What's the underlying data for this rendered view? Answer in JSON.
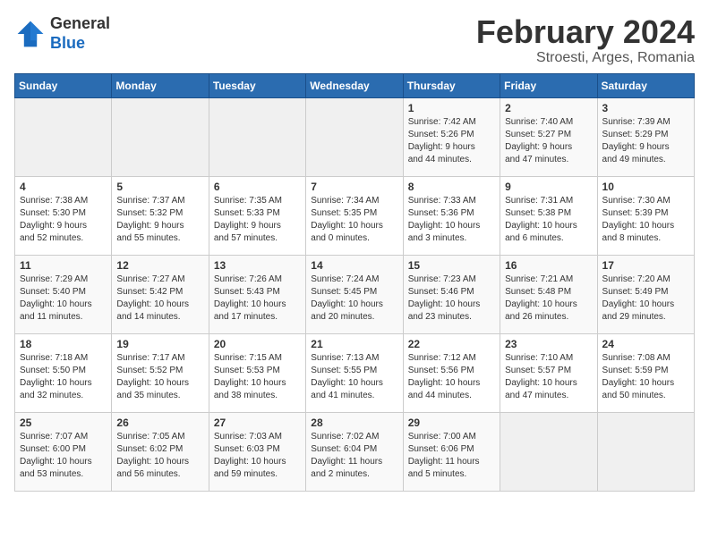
{
  "header": {
    "logo_line1": "General",
    "logo_line2": "Blue",
    "main_title": "February 2024",
    "sub_title": "Stroesti, Arges, Romania"
  },
  "days_of_week": [
    "Sunday",
    "Monday",
    "Tuesday",
    "Wednesday",
    "Thursday",
    "Friday",
    "Saturday"
  ],
  "weeks": [
    [
      {
        "day": "",
        "content": ""
      },
      {
        "day": "",
        "content": ""
      },
      {
        "day": "",
        "content": ""
      },
      {
        "day": "",
        "content": ""
      },
      {
        "day": "1",
        "content": "Sunrise: 7:42 AM\nSunset: 5:26 PM\nDaylight: 9 hours\nand 44 minutes."
      },
      {
        "day": "2",
        "content": "Sunrise: 7:40 AM\nSunset: 5:27 PM\nDaylight: 9 hours\nand 47 minutes."
      },
      {
        "day": "3",
        "content": "Sunrise: 7:39 AM\nSunset: 5:29 PM\nDaylight: 9 hours\nand 49 minutes."
      }
    ],
    [
      {
        "day": "4",
        "content": "Sunrise: 7:38 AM\nSunset: 5:30 PM\nDaylight: 9 hours\nand 52 minutes."
      },
      {
        "day": "5",
        "content": "Sunrise: 7:37 AM\nSunset: 5:32 PM\nDaylight: 9 hours\nand 55 minutes."
      },
      {
        "day": "6",
        "content": "Sunrise: 7:35 AM\nSunset: 5:33 PM\nDaylight: 9 hours\nand 57 minutes."
      },
      {
        "day": "7",
        "content": "Sunrise: 7:34 AM\nSunset: 5:35 PM\nDaylight: 10 hours\nand 0 minutes."
      },
      {
        "day": "8",
        "content": "Sunrise: 7:33 AM\nSunset: 5:36 PM\nDaylight: 10 hours\nand 3 minutes."
      },
      {
        "day": "9",
        "content": "Sunrise: 7:31 AM\nSunset: 5:38 PM\nDaylight: 10 hours\nand 6 minutes."
      },
      {
        "day": "10",
        "content": "Sunrise: 7:30 AM\nSunset: 5:39 PM\nDaylight: 10 hours\nand 8 minutes."
      }
    ],
    [
      {
        "day": "11",
        "content": "Sunrise: 7:29 AM\nSunset: 5:40 PM\nDaylight: 10 hours\nand 11 minutes."
      },
      {
        "day": "12",
        "content": "Sunrise: 7:27 AM\nSunset: 5:42 PM\nDaylight: 10 hours\nand 14 minutes."
      },
      {
        "day": "13",
        "content": "Sunrise: 7:26 AM\nSunset: 5:43 PM\nDaylight: 10 hours\nand 17 minutes."
      },
      {
        "day": "14",
        "content": "Sunrise: 7:24 AM\nSunset: 5:45 PM\nDaylight: 10 hours\nand 20 minutes."
      },
      {
        "day": "15",
        "content": "Sunrise: 7:23 AM\nSunset: 5:46 PM\nDaylight: 10 hours\nand 23 minutes."
      },
      {
        "day": "16",
        "content": "Sunrise: 7:21 AM\nSunset: 5:48 PM\nDaylight: 10 hours\nand 26 minutes."
      },
      {
        "day": "17",
        "content": "Sunrise: 7:20 AM\nSunset: 5:49 PM\nDaylight: 10 hours\nand 29 minutes."
      }
    ],
    [
      {
        "day": "18",
        "content": "Sunrise: 7:18 AM\nSunset: 5:50 PM\nDaylight: 10 hours\nand 32 minutes."
      },
      {
        "day": "19",
        "content": "Sunrise: 7:17 AM\nSunset: 5:52 PM\nDaylight: 10 hours\nand 35 minutes."
      },
      {
        "day": "20",
        "content": "Sunrise: 7:15 AM\nSunset: 5:53 PM\nDaylight: 10 hours\nand 38 minutes."
      },
      {
        "day": "21",
        "content": "Sunrise: 7:13 AM\nSunset: 5:55 PM\nDaylight: 10 hours\nand 41 minutes."
      },
      {
        "day": "22",
        "content": "Sunrise: 7:12 AM\nSunset: 5:56 PM\nDaylight: 10 hours\nand 44 minutes."
      },
      {
        "day": "23",
        "content": "Sunrise: 7:10 AM\nSunset: 5:57 PM\nDaylight: 10 hours\nand 47 minutes."
      },
      {
        "day": "24",
        "content": "Sunrise: 7:08 AM\nSunset: 5:59 PM\nDaylight: 10 hours\nand 50 minutes."
      }
    ],
    [
      {
        "day": "25",
        "content": "Sunrise: 7:07 AM\nSunset: 6:00 PM\nDaylight: 10 hours\nand 53 minutes."
      },
      {
        "day": "26",
        "content": "Sunrise: 7:05 AM\nSunset: 6:02 PM\nDaylight: 10 hours\nand 56 minutes."
      },
      {
        "day": "27",
        "content": "Sunrise: 7:03 AM\nSunset: 6:03 PM\nDaylight: 10 hours\nand 59 minutes."
      },
      {
        "day": "28",
        "content": "Sunrise: 7:02 AM\nSunset: 6:04 PM\nDaylight: 11 hours\nand 2 minutes."
      },
      {
        "day": "29",
        "content": "Sunrise: 7:00 AM\nSunset: 6:06 PM\nDaylight: 11 hours\nand 5 minutes."
      },
      {
        "day": "",
        "content": ""
      },
      {
        "day": "",
        "content": ""
      }
    ]
  ]
}
